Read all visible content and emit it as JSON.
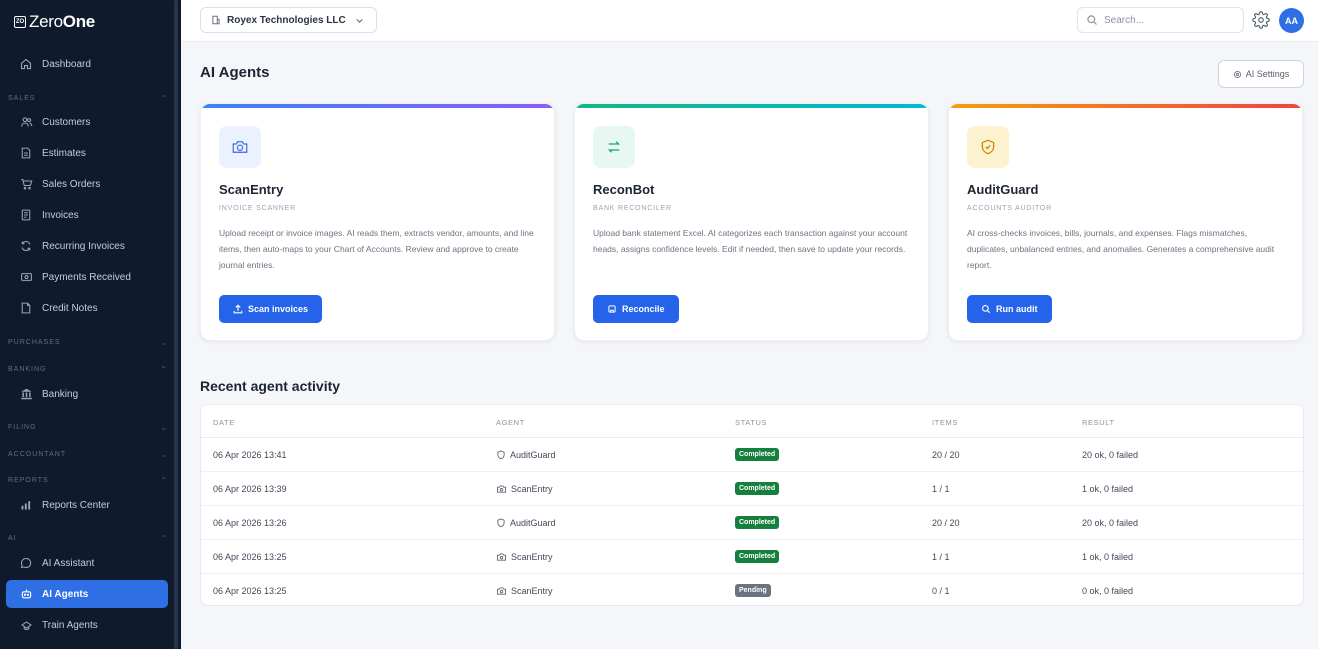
{
  "brand": {
    "mark": "ZO",
    "name_light": "Zero",
    "name_bold": "One"
  },
  "sidebar": {
    "items": [
      {
        "label": "Dashboard",
        "icon": "home-icon"
      },
      {
        "label": "Customers",
        "icon": "users-icon"
      },
      {
        "label": "Estimates",
        "icon": "file-icon"
      },
      {
        "label": "Sales Orders",
        "icon": "cart-icon"
      },
      {
        "label": "Invoices",
        "icon": "invoice-icon"
      },
      {
        "label": "Recurring Invoices",
        "icon": "repeat-icon"
      },
      {
        "label": "Payments Received",
        "icon": "cash-icon"
      },
      {
        "label": "Credit Notes",
        "icon": "note-icon"
      },
      {
        "label": "Banking",
        "icon": "bank-icon"
      },
      {
        "label": "Reports Center",
        "icon": "chart-icon"
      },
      {
        "label": "AI Assistant",
        "icon": "chat-icon"
      },
      {
        "label": "AI Agents",
        "icon": "robot-icon"
      },
      {
        "label": "Train Agents",
        "icon": "train-icon"
      }
    ],
    "sections": [
      "SALES",
      "PURCHASES",
      "BANKING",
      "FILING",
      "ACCOUNTANT",
      "REPORTS",
      "AI"
    ],
    "active_color": "#2f6fe4"
  },
  "topbar": {
    "company": "Royex Technologies LLC",
    "search_placeholder": "Search...",
    "avatar": "AA"
  },
  "page": {
    "title": "AI Agents",
    "settings_label": "AI Settings"
  },
  "agents": [
    {
      "name": "ScanEntry",
      "subtitle": "INVOICE SCANNER",
      "description": "Upload receipt or invoice images. AI reads them, extracts vendor, amounts, and line items, then auto-maps to your Chart of Accounts. Review and approve to create journal entries.",
      "button": "Scan invoices",
      "icon": "camera-icon",
      "accent": "#6d5df0"
    },
    {
      "name": "ReconBot",
      "subtitle": "BANK RECONCILER",
      "description": "Upload bank statement Excel. AI categorizes each transaction against your account heads, assigns confidence levels. Edit if needed, then save to update your records.",
      "button": "Reconcile",
      "icon": "swap-icon",
      "accent": "#14b8a6"
    },
    {
      "name": "AuditGuard",
      "subtitle": "ACCOUNTS AUDITOR",
      "description": "AI cross-checks invoices, bills, journals, and expenses. Flags mismatches, duplicates, unbalanced entries, and anomalies. Generates a comprehensive audit report.",
      "button": "Run audit",
      "icon": "shield-icon",
      "accent": "#ef4444"
    }
  ],
  "activity": {
    "title": "Recent agent activity",
    "headers": [
      "DATE",
      "AGENT",
      "STATUS",
      "ITEMS",
      "RESULT"
    ],
    "rows": [
      {
        "date": "06 Apr 2026 13:41",
        "agent": "AuditGuard",
        "status": "Completed",
        "items": "20 / 20",
        "result": "20 ok, 0 failed"
      },
      {
        "date": "06 Apr 2026 13:39",
        "agent": "ScanEntry",
        "status": "Completed",
        "items": "1 / 1",
        "result": "1 ok, 0 failed"
      },
      {
        "date": "06 Apr 2026 13:26",
        "agent": "AuditGuard",
        "status": "Completed",
        "items": "20 / 20",
        "result": "20 ok, 0 failed"
      },
      {
        "date": "06 Apr 2026 13:25",
        "agent": "ScanEntry",
        "status": "Completed",
        "items": "1 / 1",
        "result": "1 ok, 0 failed"
      },
      {
        "date": "06 Apr 2026 13:25",
        "agent": "ScanEntry",
        "status": "Pending",
        "items": "0 / 1",
        "result": "0 ok, 0 failed"
      }
    ],
    "status_colors": {
      "Completed": "#15803d",
      "Pending": "#6b7280"
    }
  }
}
